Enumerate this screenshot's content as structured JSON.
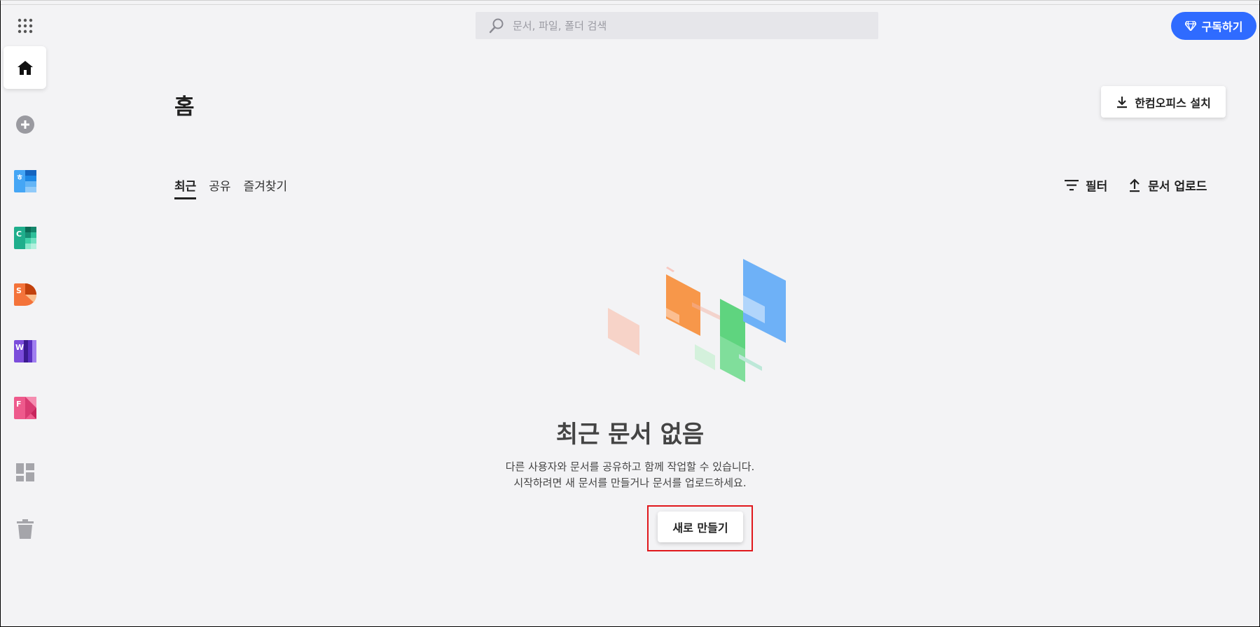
{
  "search": {
    "placeholder": "문서, 파일, 폴더 검색"
  },
  "header": {
    "subscribe_label": "구독하기"
  },
  "main": {
    "title": "홈",
    "install_label": "한컴오피스 설치",
    "tabs": [
      {
        "label": "최근",
        "active": true
      },
      {
        "label": "공유",
        "active": false
      },
      {
        "label": "즐겨찾기",
        "active": false
      }
    ],
    "filter_label": "필터",
    "upload_label": "문서 업로드"
  },
  "empty_state": {
    "title": "최근 문서 없음",
    "line1": "다른 사용자와 문서를 공유하고 함께 작업할 수 있습니다.",
    "line2": "시작하려면 새 문서를 만들거나 문서를 업로드하세요.",
    "create_label": "새로 만들기"
  },
  "sidebar": {
    "items": [
      {
        "name": "apps-grid-icon"
      },
      {
        "name": "home-icon",
        "active": true
      },
      {
        "name": "add-icon"
      },
      {
        "name": "docs-app-icon",
        "letter": "ㅎ",
        "color": "#2d8cf0"
      },
      {
        "name": "calc-app-icon",
        "letter": "C",
        "color": "#14a085"
      },
      {
        "name": "show-app-icon",
        "letter": "S",
        "color": "#f05a28"
      },
      {
        "name": "word-app-icon",
        "letter": "W",
        "color": "#6b3fd4"
      },
      {
        "name": "pdf-app-icon",
        "letter": "F",
        "color": "#e8457a"
      },
      {
        "name": "templates-icon"
      },
      {
        "name": "trash-icon"
      }
    ]
  },
  "colors": {
    "accent": "#2f6bff",
    "highlight": "#e0181c"
  }
}
